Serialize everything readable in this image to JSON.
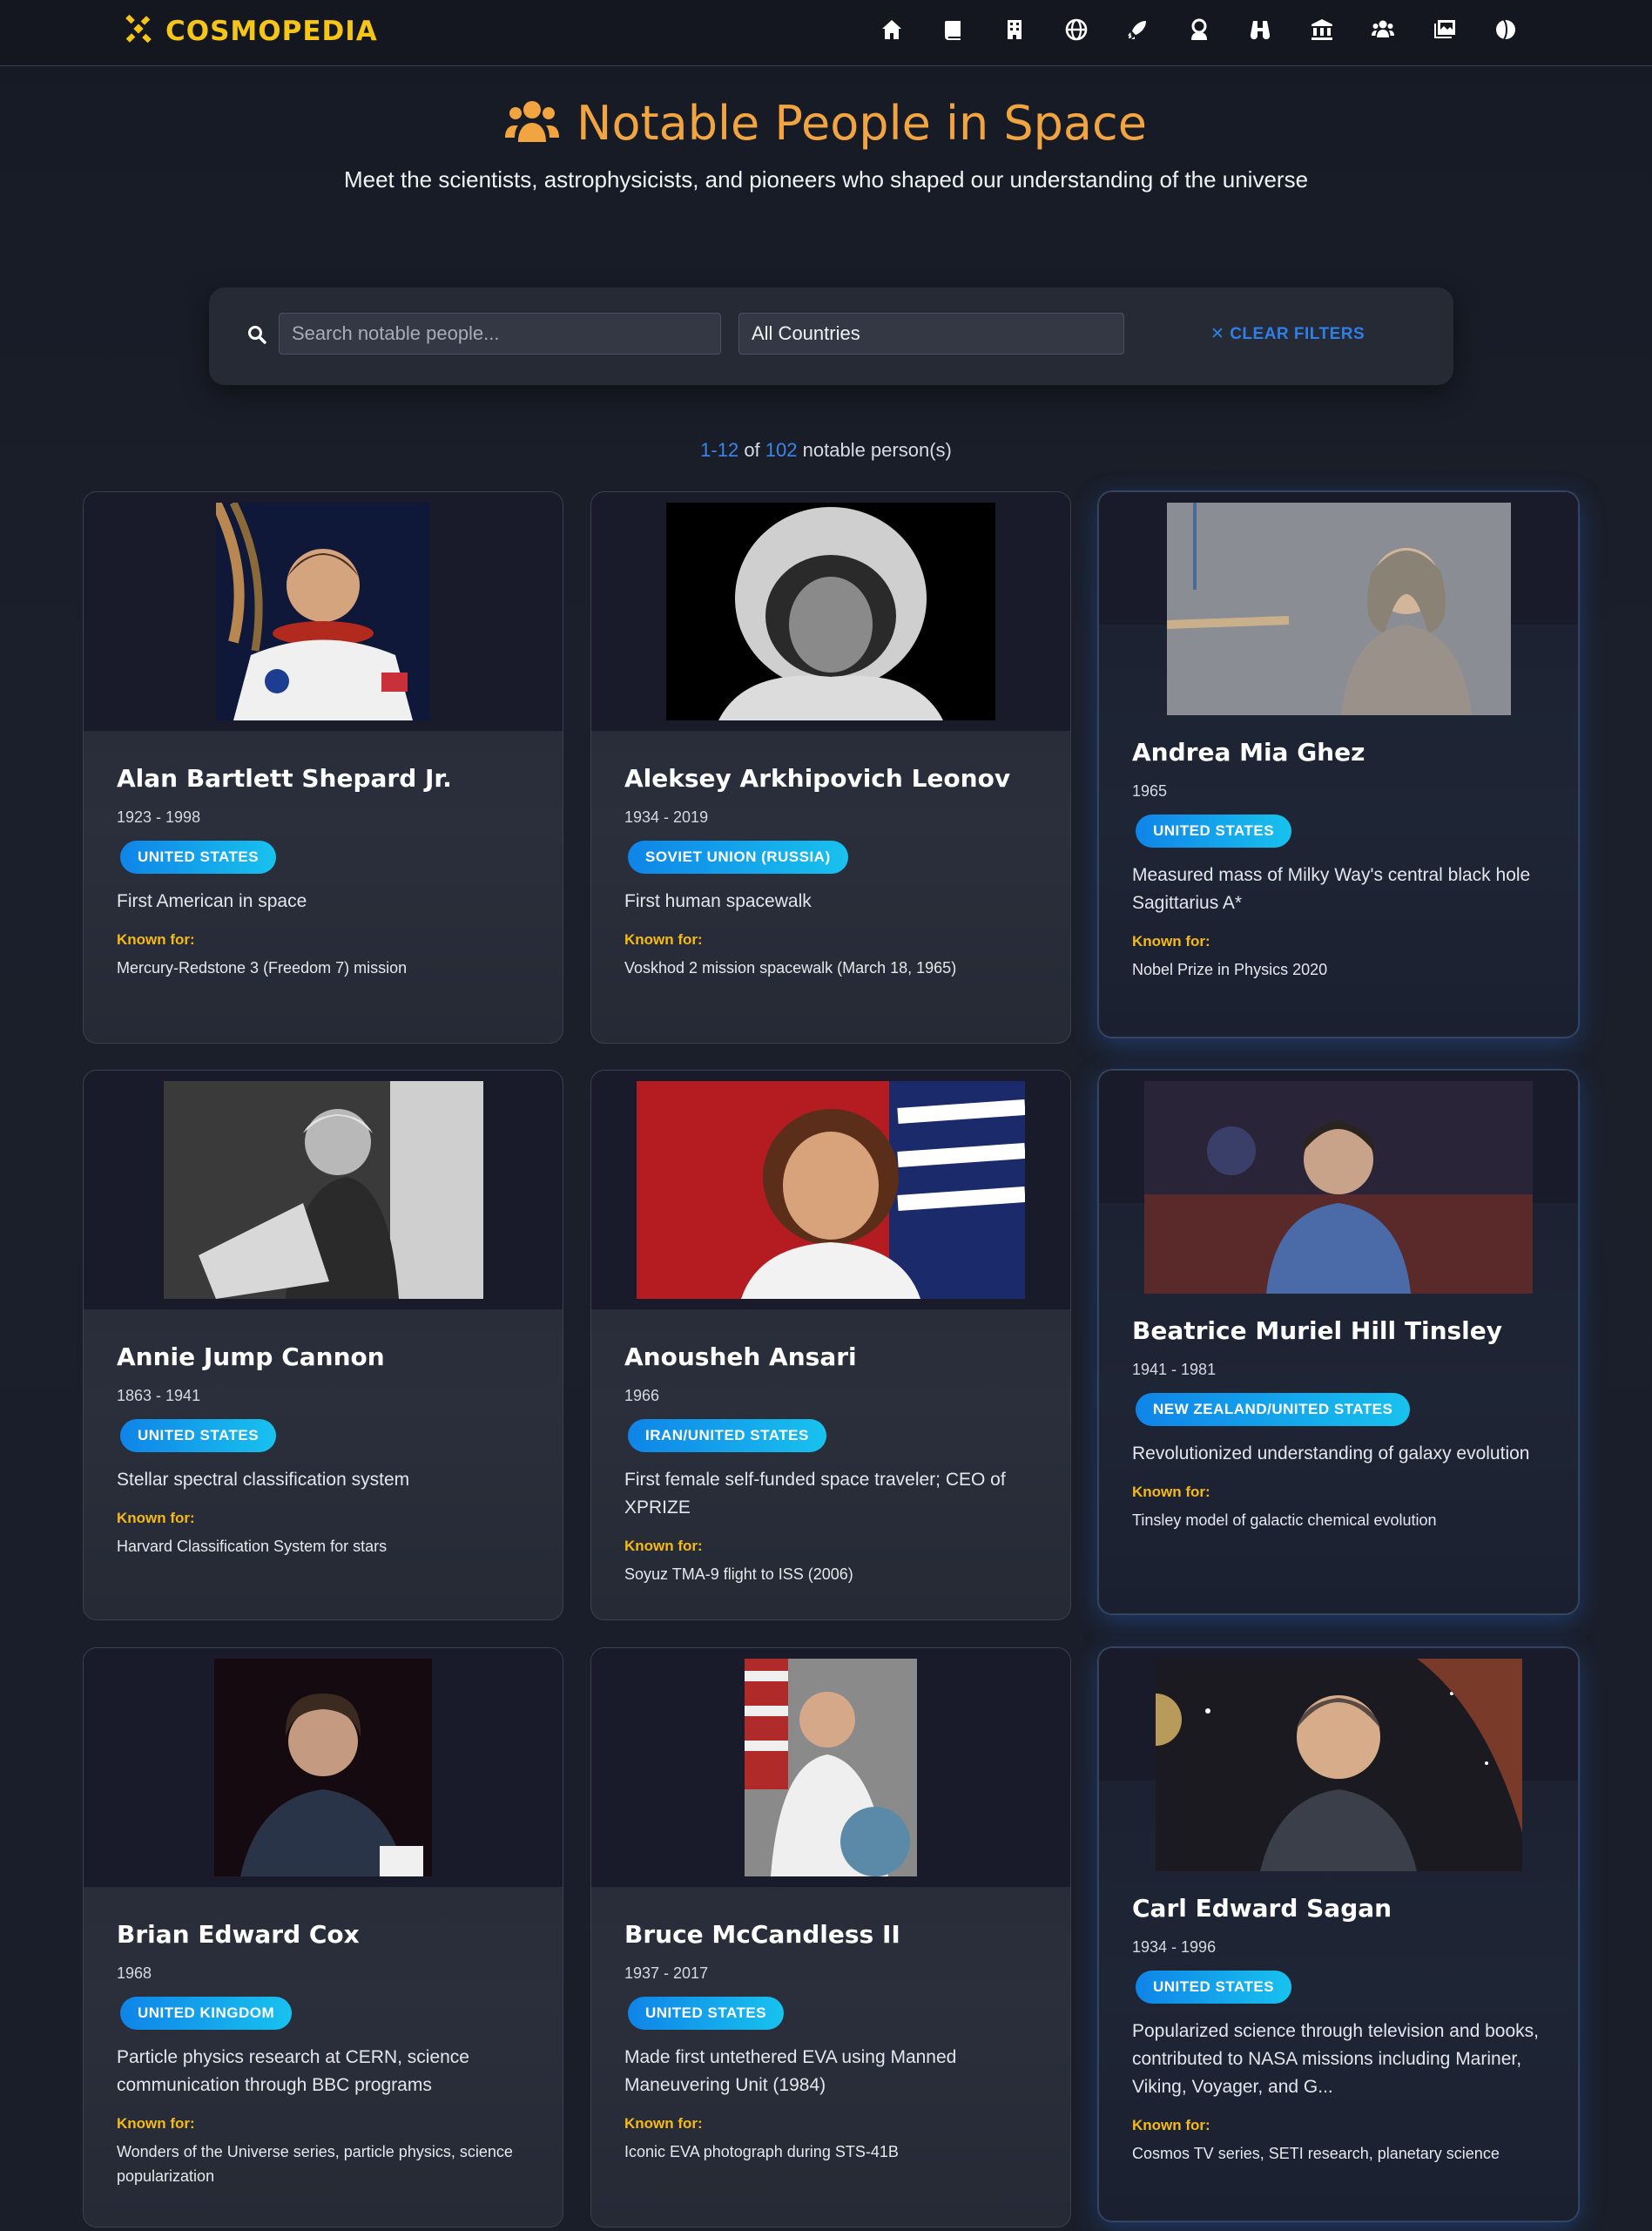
{
  "brand": {
    "name": "COSMOPEDIA"
  },
  "nav": {
    "icons": [
      "home-icon",
      "book-icon",
      "building-icon",
      "globe-icon",
      "rocket-icon",
      "astronaut-icon",
      "binoculars-icon",
      "museum-icon",
      "people-icon",
      "gallery-icon",
      "moon-icon"
    ]
  },
  "header": {
    "title": "Notable People in Space",
    "subtitle": "Meet the scientists, astrophysicists, and pioneers who shaped our understanding of the universe"
  },
  "filters": {
    "search_placeholder": "Search notable people...",
    "country_value": "All Countries",
    "clear_label": "✕ CLEAR FILTERS"
  },
  "results": {
    "range": "1-12",
    "of_label": "of",
    "total": "102",
    "suffix": "notable person(s)"
  },
  "known_label": "Known for:",
  "people": [
    {
      "name": "Alan Bartlett Shepard Jr.",
      "years": "1923 - 1998",
      "country": "UNITED STATES",
      "description": "First American in space",
      "known_for": "Mercury-Redstone 3 (Freedom 7) mission"
    },
    {
      "name": "Aleksey Arkhipovich Leonov",
      "years": "1934 - 2019",
      "country": "SOVIET UNION (RUSSIA)",
      "description": "First human spacewalk",
      "known_for": "Voskhod 2 mission spacewalk (March 18, 1965)"
    },
    {
      "name": "Andrea Mia Ghez",
      "years": "1965",
      "country": "UNITED STATES",
      "description": "Measured mass of Milky Way's central black hole Sagittarius A*",
      "known_for": "Nobel Prize in Physics 2020"
    },
    {
      "name": "Annie Jump Cannon",
      "years": "1863 - 1941",
      "country": "UNITED STATES",
      "description": "Stellar spectral classification system",
      "known_for": "Harvard Classification System for stars"
    },
    {
      "name": "Anousheh Ansari",
      "years": "1966",
      "country": "IRAN/UNITED STATES",
      "description": "First female self-funded space traveler; CEO of XPRIZE",
      "known_for": "Soyuz TMA-9 flight to ISS (2006)"
    },
    {
      "name": "Beatrice Muriel Hill Tinsley",
      "years": "1941 - 1981",
      "country": "NEW ZEALAND/UNITED STATES",
      "description": "Revolutionized understanding of galaxy evolution",
      "known_for": "Tinsley model of galactic chemical evolution"
    },
    {
      "name": "Brian Edward Cox",
      "years": "1968",
      "country": "UNITED KINGDOM",
      "description": "Particle physics research at CERN, science communication through BBC programs",
      "known_for": "Wonders of the Universe series, particle physics, science popularization"
    },
    {
      "name": "Bruce McCandless II",
      "years": "1937 - 2017",
      "country": "UNITED STATES",
      "description": "Made first untethered EVA using Manned Maneuvering Unit (1984)",
      "known_for": "Iconic EVA photograph during STS-41B"
    },
    {
      "name": "Carl Edward Sagan",
      "years": "1934 - 1996",
      "country": "UNITED STATES",
      "description": "Popularized science through television and books, contributed to NASA missions including Mariner, Viking, Voyager, and G...",
      "known_for": "Cosmos TV series, SETI research, planetary science"
    }
  ]
}
